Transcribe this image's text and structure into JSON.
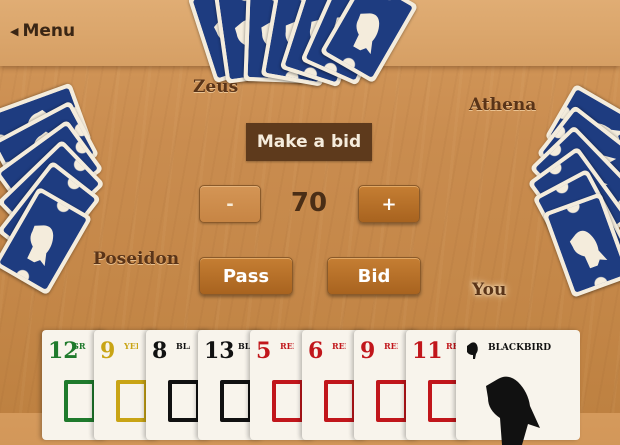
{
  "menu": {
    "label": "Menu"
  },
  "players": {
    "north": "Zeus",
    "east": "Athena",
    "west": "Poseidon",
    "south": "You"
  },
  "bidding": {
    "title": "Make a bid",
    "minus_label": "-",
    "plus_label": "+",
    "value": "70",
    "pass_label": "Pass",
    "bid_label": "Bid"
  },
  "hand": [
    {
      "number": "12",
      "name": "GREEN",
      "color": "#1f7a2c"
    },
    {
      "number": "9",
      "name": "YELLOW",
      "color": "#c9a415"
    },
    {
      "number": "8",
      "name": "BLACK",
      "color": "#111111"
    },
    {
      "number": "13",
      "name": "BLACK",
      "color": "#111111"
    },
    {
      "number": "5",
      "name": "RED",
      "color": "#c1161b"
    },
    {
      "number": "6",
      "name": "RED",
      "color": "#c1161b"
    },
    {
      "number": "9",
      "name": "RED",
      "color": "#c1161b"
    },
    {
      "number": "11",
      "name": "RED",
      "color": "#c1161b"
    },
    {
      "number": "",
      "name": "BLACKBIRD",
      "color": "#111111"
    }
  ],
  "colors": {
    "card_back": "#1e3c80",
    "button_active": "#a8631f",
    "title_bg": "#5e3a1c"
  },
  "icons": {
    "menu": "chevron-left-icon",
    "card_bird": "raven-silhouette-icon"
  }
}
